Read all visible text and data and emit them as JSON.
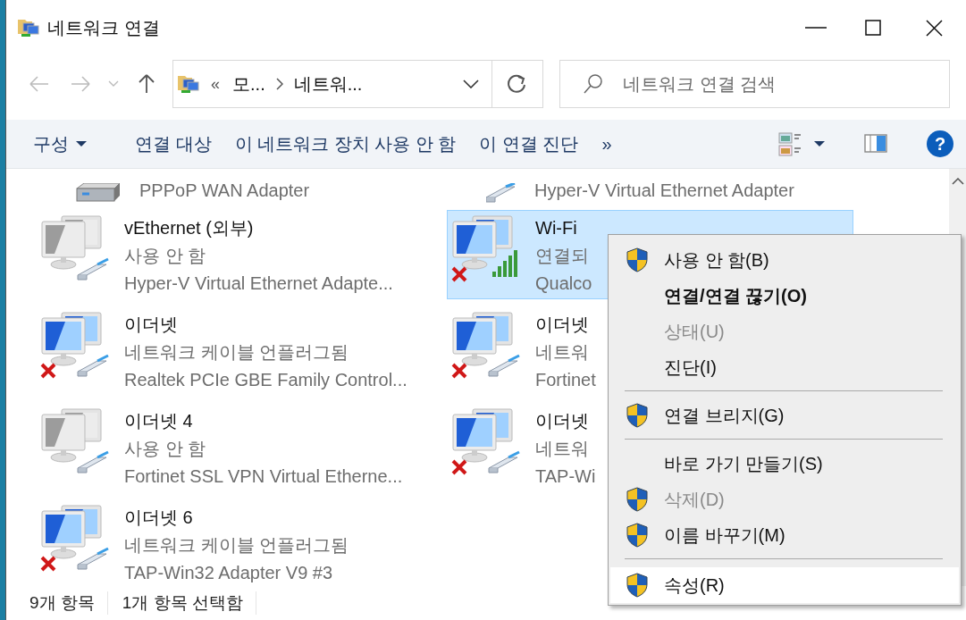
{
  "window": {
    "title": "네트워크 연결"
  },
  "address": {
    "overflow": "«",
    "crumbs": [
      "모...",
      "네트워..."
    ]
  },
  "search": {
    "placeholder": "네트워크 연결 검색"
  },
  "help": {
    "label": "?"
  },
  "commands": [
    {
      "label": "구성",
      "dropdown": true
    },
    {
      "label": "연결 대상",
      "dropdown": false
    },
    {
      "label": "이 네트워크 장치 사용 안 함",
      "dropdown": false
    },
    {
      "label": "이 연결 진단",
      "dropdown": false
    },
    {
      "label": "»",
      "dropdown": false
    }
  ],
  "partial_items": [
    {
      "kind": "modem",
      "device": "PPPoP WAN Adapter"
    },
    {
      "kind": "ethernet",
      "device": "Hyper-V Virtual Ethernet Adapter"
    }
  ],
  "items": [
    {
      "name": "vEthernet (외부)",
      "status": "사용 안 함",
      "device": "Hyper-V Virtual Ethernet Adapte...",
      "kind": "ethernet",
      "enabled": false,
      "disconnected": false,
      "selected": false
    },
    {
      "name": "Wi-Fi",
      "status": "연결되",
      "device": "Qualco",
      "kind": "wifi",
      "enabled": true,
      "disconnected": true,
      "selected": true
    },
    {
      "name": "이더넷",
      "status": "네트워크 케이블 언플러그됨",
      "device": "Realtek PCIe GBE Family Control...",
      "kind": "ethernet",
      "enabled": true,
      "disconnected": true,
      "selected": false
    },
    {
      "name": "이더넷",
      "status": "네트워",
      "device": "Fortinet",
      "kind": "ethernet",
      "enabled": true,
      "disconnected": true,
      "selected": false
    },
    {
      "name": "이더넷 4",
      "status": "사용 안 함",
      "device": "Fortinet SSL VPN Virtual Etherne...",
      "kind": "ethernet",
      "enabled": false,
      "disconnected": false,
      "selected": false
    },
    {
      "name": "이더넷",
      "status": "네트워",
      "device": "TAP-Wi",
      "kind": "ethernet",
      "enabled": true,
      "disconnected": true,
      "selected": false
    },
    {
      "name": "이더넷 6",
      "status": "네트워크 케이블 언플러그됨",
      "device": "TAP-Win32 Adapter V9 #3",
      "kind": "ethernet",
      "enabled": true,
      "disconnected": true,
      "selected": false
    }
  ],
  "status_bar": [
    "9개 항목",
    "1개 항목 선택함"
  ],
  "context_menu": [
    {
      "kind": "item",
      "label": "사용 안 함(B)",
      "shield": true,
      "bold": false,
      "disabled": false,
      "highlighted": false
    },
    {
      "kind": "item",
      "label": "연결/연결 끊기(O)",
      "shield": false,
      "bold": true,
      "disabled": false,
      "highlighted": false
    },
    {
      "kind": "item",
      "label": "상태(U)",
      "shield": false,
      "bold": false,
      "disabled": true,
      "highlighted": false
    },
    {
      "kind": "item",
      "label": "진단(I)",
      "shield": false,
      "bold": false,
      "disabled": false,
      "highlighted": false
    },
    {
      "kind": "separator"
    },
    {
      "kind": "item",
      "label": "연결 브리지(G)",
      "shield": true,
      "bold": false,
      "disabled": false,
      "highlighted": false
    },
    {
      "kind": "separator"
    },
    {
      "kind": "item",
      "label": "바로 가기 만들기(S)",
      "shield": false,
      "bold": false,
      "disabled": false,
      "highlighted": false
    },
    {
      "kind": "item",
      "label": "삭제(D)",
      "shield": true,
      "bold": false,
      "disabled": true,
      "highlighted": false
    },
    {
      "kind": "item",
      "label": "이름 바꾸기(M)",
      "shield": true,
      "bold": false,
      "disabled": false,
      "highlighted": false
    },
    {
      "kind": "separator"
    },
    {
      "kind": "item",
      "label": "속성(R)",
      "shield": true,
      "bold": false,
      "disabled": false,
      "highlighted": true
    }
  ]
}
